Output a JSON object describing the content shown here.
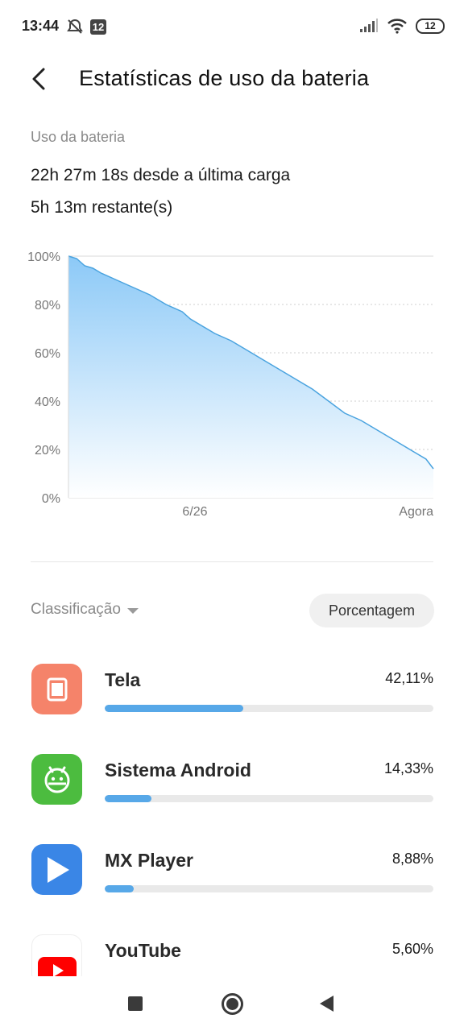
{
  "status_bar": {
    "time": "13:44",
    "notification_badge": "12",
    "battery_level": "12",
    "icons": [
      "alarm-off-icon",
      "notification-badge-icon",
      "signal-icon",
      "wifi-icon",
      "battery-icon"
    ]
  },
  "header": {
    "back_icon": "chevron-left-icon",
    "title": "Estatísticas de uso da bateria"
  },
  "summary": {
    "section_label": "Uso da bateria",
    "since_last_charge": "22h 27m 18s desde a última carga",
    "remaining": "5h 13m restante(s)"
  },
  "chart_data": {
    "type": "area",
    "title": "",
    "xlabel": "",
    "ylabel": "",
    "y_ticks": [
      "100%",
      "80%",
      "60%",
      "40%",
      "20%",
      "0%"
    ],
    "x_tick_labels": [
      "6/26",
      "Agora"
    ],
    "ylim": [
      0,
      100
    ],
    "grid": true,
    "fill_color_top": "#8cc9f7",
    "fill_color_bottom": "#ffffff",
    "line_color": "#4aa3df",
    "series": [
      {
        "x": [
          0,
          0.5,
          1,
          1.5,
          2,
          3,
          4,
          5,
          6,
          7,
          7.5,
          8,
          9,
          10,
          11,
          12,
          13,
          14,
          15,
          16,
          17,
          18,
          19,
          20,
          21,
          22,
          22.45
        ],
        "values": [
          100,
          99,
          96,
          95,
          93,
          90,
          87,
          84,
          80,
          77,
          74,
          72,
          68,
          65,
          61,
          57,
          53,
          49,
          45,
          40,
          35,
          32,
          28,
          24,
          20,
          16,
          12
        ]
      }
    ]
  },
  "sort": {
    "label": "Classificação",
    "mode_button": "Porcentagem"
  },
  "apps": [
    {
      "name": "Tela",
      "percent_label": "42,11%",
      "percent": 42.11,
      "icon": "screen-icon",
      "icon_color": "#f5836a"
    },
    {
      "name": "Sistema Android",
      "percent_label": "14,33%",
      "percent": 14.33,
      "icon": "android-icon",
      "icon_color": "#4cbc3f"
    },
    {
      "name": "MX Player",
      "percent_label": "8,88%",
      "percent": 8.88,
      "icon": "play-icon",
      "icon_color": "#3a86e6"
    },
    {
      "name": "YouTube",
      "percent_label": "5,60%",
      "percent": 5.6,
      "icon": "youtube-icon",
      "icon_color": "#ff0000"
    }
  ],
  "nav_bar": {
    "icons": [
      "recent-apps-icon",
      "home-icon",
      "back-icon"
    ]
  }
}
